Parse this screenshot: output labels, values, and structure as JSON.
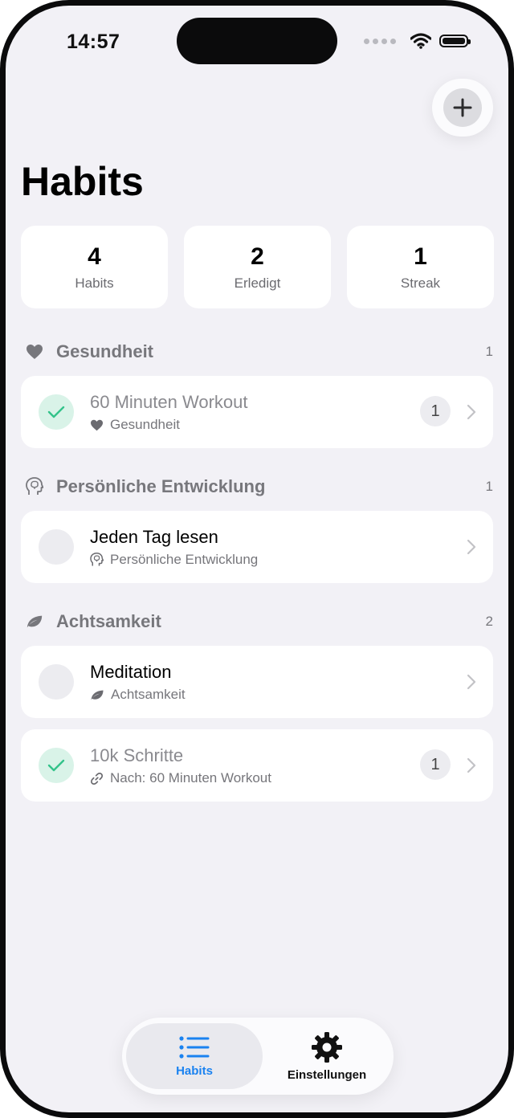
{
  "status_bar": {
    "time": "14:57"
  },
  "header": {
    "title": "Habits",
    "add_icon": "plus-icon"
  },
  "stats": [
    {
      "value": "4",
      "label": "Habits"
    },
    {
      "value": "2",
      "label": "Erledigt"
    },
    {
      "value": "1",
      "label": "Streak"
    }
  ],
  "sections": [
    {
      "title": "Gesundheit",
      "count": "1",
      "icon": "heart-icon",
      "items": [
        {
          "name": "60 Minuten Workout",
          "subtitle": "Gesundheit",
          "done": true,
          "badge": "1",
          "sub_icon": "heart-icon"
        }
      ]
    },
    {
      "title": "Persönliche Entwicklung",
      "count": "1",
      "icon": "brain-head-icon",
      "items": [
        {
          "name": "Jeden Tag lesen",
          "subtitle": "Persönliche Entwicklung",
          "done": false,
          "sub_icon": "brain-head-icon"
        }
      ]
    },
    {
      "title": "Achtsamkeit",
      "count": "2",
      "icon": "leaf-icon",
      "items": [
        {
          "name": "Meditation",
          "subtitle": "Achtsamkeit",
          "done": false,
          "sub_icon": "leaf-icon"
        },
        {
          "name": "10k Schritte",
          "subtitle": "Nach: 60 Minuten Workout",
          "done": true,
          "badge": "1",
          "sub_icon": "link-icon"
        }
      ]
    }
  ],
  "tabbar": {
    "tabs": [
      {
        "label": "Habits",
        "icon": "list-icon",
        "active": true
      },
      {
        "label": "Einstellungen",
        "icon": "gear-icon",
        "active": false
      }
    ]
  },
  "colors": {
    "accent": "#1a82f0",
    "done_check": "#33c38a",
    "done_bg": "#d9f3e8"
  }
}
